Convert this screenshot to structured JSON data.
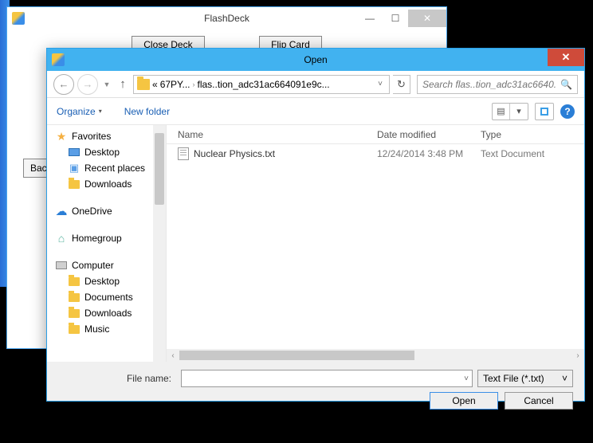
{
  "bg": {
    "title": "FlashDeck",
    "closeDeck": "Close Deck",
    "flipCard": "Flip Card",
    "back": "Back",
    "min": "—",
    "max": "☐",
    "close": "✕"
  },
  "dialog": {
    "title": "Open",
    "close": "✕"
  },
  "nav": {
    "back": "←",
    "fwd": "→",
    "dd": "▼",
    "up": "↑",
    "refresh": "↻",
    "chev": "«",
    "seg1": "67PY...",
    "sep": "›",
    "seg2": "flas..tion_adc31ac664091e9c...",
    "addrdd": "˅",
    "search_placeholder": "Search flas..tion_adc31ac6640...",
    "search_icon": "🔍"
  },
  "toolbar": {
    "organize": "Organize",
    "dd": "▾",
    "newfolder": "New folder",
    "view1": "▤",
    "view2": "▾",
    "help": "?"
  },
  "sidebar": {
    "favorites": "Favorites",
    "desktop": "Desktop",
    "recent": "Recent places",
    "downloads": "Downloads",
    "onedrive": "OneDrive",
    "homegroup": "Homegroup",
    "computer": "Computer",
    "c_desktop": "Desktop",
    "c_documents": "Documents",
    "c_downloads": "Downloads",
    "c_music": "Music"
  },
  "columns": {
    "name": "Name",
    "date": "Date modified",
    "type": "Type"
  },
  "files": [
    {
      "name": "Nuclear Physics.txt",
      "date": "12/24/2014 3:48 PM",
      "type": "Text Document"
    }
  ],
  "bottom": {
    "filename_label": "File name:",
    "filename_value": "",
    "filter": "Text File (*.txt)",
    "dd": "˅",
    "open": "Open",
    "cancel": "Cancel"
  },
  "scroll": {
    "left": "‹",
    "right": "›"
  }
}
